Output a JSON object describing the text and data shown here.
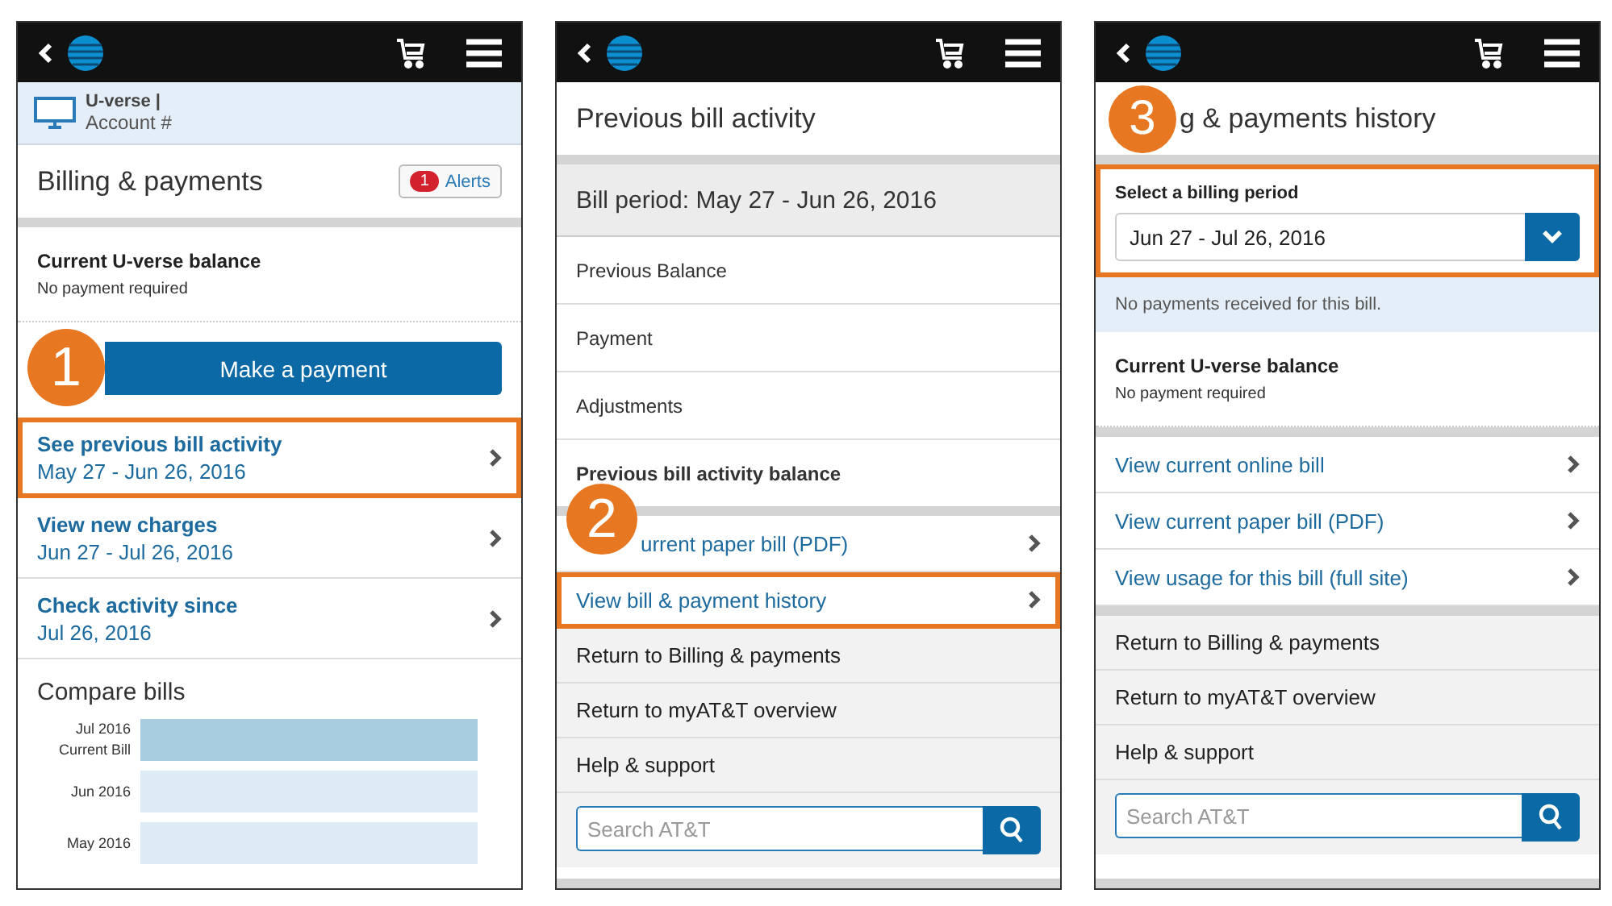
{
  "panels": [
    {
      "sections": [
        [
          {
            "kind": "account",
            "line1": "U-verse |",
            "line2": "Account #"
          },
          {
            "kind": "page_title",
            "text": "Billing & payments",
            "alerts": {
              "count": "1",
              "label": "Alerts"
            }
          }
        ],
        [
          {
            "kind": "balance",
            "title": "Current U-verse balance",
            "subtitle": "No payment required"
          },
          {
            "kind": "button",
            "label": "Make a payment",
            "step": "1"
          },
          {
            "kind": "link_row",
            "title": "See previous bill activity",
            "subtitle": "May 27 - Jun 26, 2016",
            "highlighted": true
          },
          {
            "kind": "link_row",
            "title": "View new charges",
            "subtitle": "Jun 27 - Jul 26, 2016",
            "highlighted": false
          },
          {
            "kind": "link_row",
            "title": "Check activity since",
            "subtitle": "Jul 26, 2016",
            "highlighted": false
          },
          {
            "kind": "compare",
            "title": "Compare bills",
            "bars": [
              {
                "label": "Jul 2016",
                "sublabel": "Current Bill",
                "current": true
              },
              {
                "label": "Jun 2016",
                "current": false
              },
              {
                "label": "May 2016",
                "current": false
              }
            ]
          }
        ]
      ]
    },
    {
      "sections": [
        [
          {
            "kind": "page_title",
            "text": "Previous bill activity"
          }
        ],
        [
          {
            "kind": "period",
            "text": "Bill period: May 27 - Jun 26, 2016"
          },
          {
            "kind": "plain_row",
            "text": "Previous Balance",
            "bold": false
          },
          {
            "kind": "plain_row",
            "text": "Payment",
            "bold": false
          },
          {
            "kind": "plain_row",
            "text": "Adjustments",
            "bold": false
          },
          {
            "kind": "plain_row",
            "text": "Previous bill activity balance",
            "bold": true
          }
        ],
        [
          {
            "kind": "link",
            "text": "urrent paper bill (PDF)",
            "step": "2",
            "highlighted": false
          },
          {
            "kind": "link",
            "text": "View bill & payment history",
            "highlighted": true
          },
          {
            "kind": "nav",
            "text": "Return to Billing & payments"
          },
          {
            "kind": "nav",
            "text": "Return to myAT&T overview"
          },
          {
            "kind": "nav",
            "text": "Help & support"
          },
          {
            "kind": "search",
            "placeholder": "Search AT&T"
          }
        ]
      ]
    },
    {
      "sections": [
        [
          {
            "kind": "page_title",
            "text": "g & payments history",
            "step": "3"
          }
        ],
        [
          {
            "kind": "select",
            "label": "Select a billing period",
            "value": "Jun 27 - Jul 26, 2016",
            "highlighted": true
          },
          {
            "kind": "notice",
            "text": "No payments received for this bill."
          },
          {
            "kind": "balance",
            "title": "Current U-verse balance",
            "subtitle": "No payment required"
          }
        ],
        [
          {
            "kind": "link",
            "text": "View current online bill",
            "highlighted": false
          },
          {
            "kind": "link",
            "text": "View current paper bill (PDF)",
            "highlighted": false
          },
          {
            "kind": "link",
            "text": "View usage for this bill (full site)",
            "highlighted": false
          }
        ],
        [
          {
            "kind": "nav",
            "text": "Return to Billing & payments"
          },
          {
            "kind": "nav",
            "text": "Return to myAT&T overview"
          },
          {
            "kind": "nav",
            "text": "Help & support"
          },
          {
            "kind": "search",
            "placeholder": "Search AT&T"
          }
        ]
      ]
    }
  ]
}
